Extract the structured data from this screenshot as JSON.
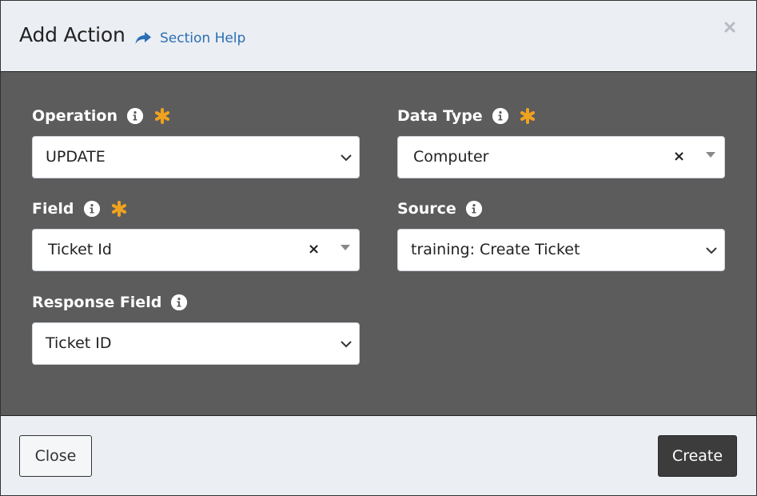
{
  "header": {
    "title": "Add Action",
    "help_label": "Section Help"
  },
  "form": {
    "operation": {
      "label": "Operation",
      "value": "UPDATE",
      "required": true
    },
    "data_type": {
      "label": "Data Type",
      "value": "Computer",
      "clear": "×",
      "required": true
    },
    "field": {
      "label": "Field",
      "value": "Ticket Id",
      "clear": "×",
      "required": true
    },
    "source": {
      "label": "Source",
      "value": "training: Create Ticket",
      "required": false
    },
    "response_field": {
      "label": "Response Field",
      "value": "Ticket ID",
      "required": false
    }
  },
  "footer": {
    "close_label": "Close",
    "create_label": "Create"
  },
  "colors": {
    "accent_link": "#2b6fb4",
    "required_star": "#f0a21f",
    "body_bg": "#5c5c5c",
    "header_bg": "#ebeef3",
    "primary_button": "#3c3c3c"
  },
  "icons": {
    "help": "share-arrow-icon",
    "close": "close-icon",
    "info": "info-icon",
    "required": "asterisk-icon",
    "dropdown": "chevron-down-icon",
    "clear": "clear-icon",
    "caret": "caret-down-icon"
  }
}
